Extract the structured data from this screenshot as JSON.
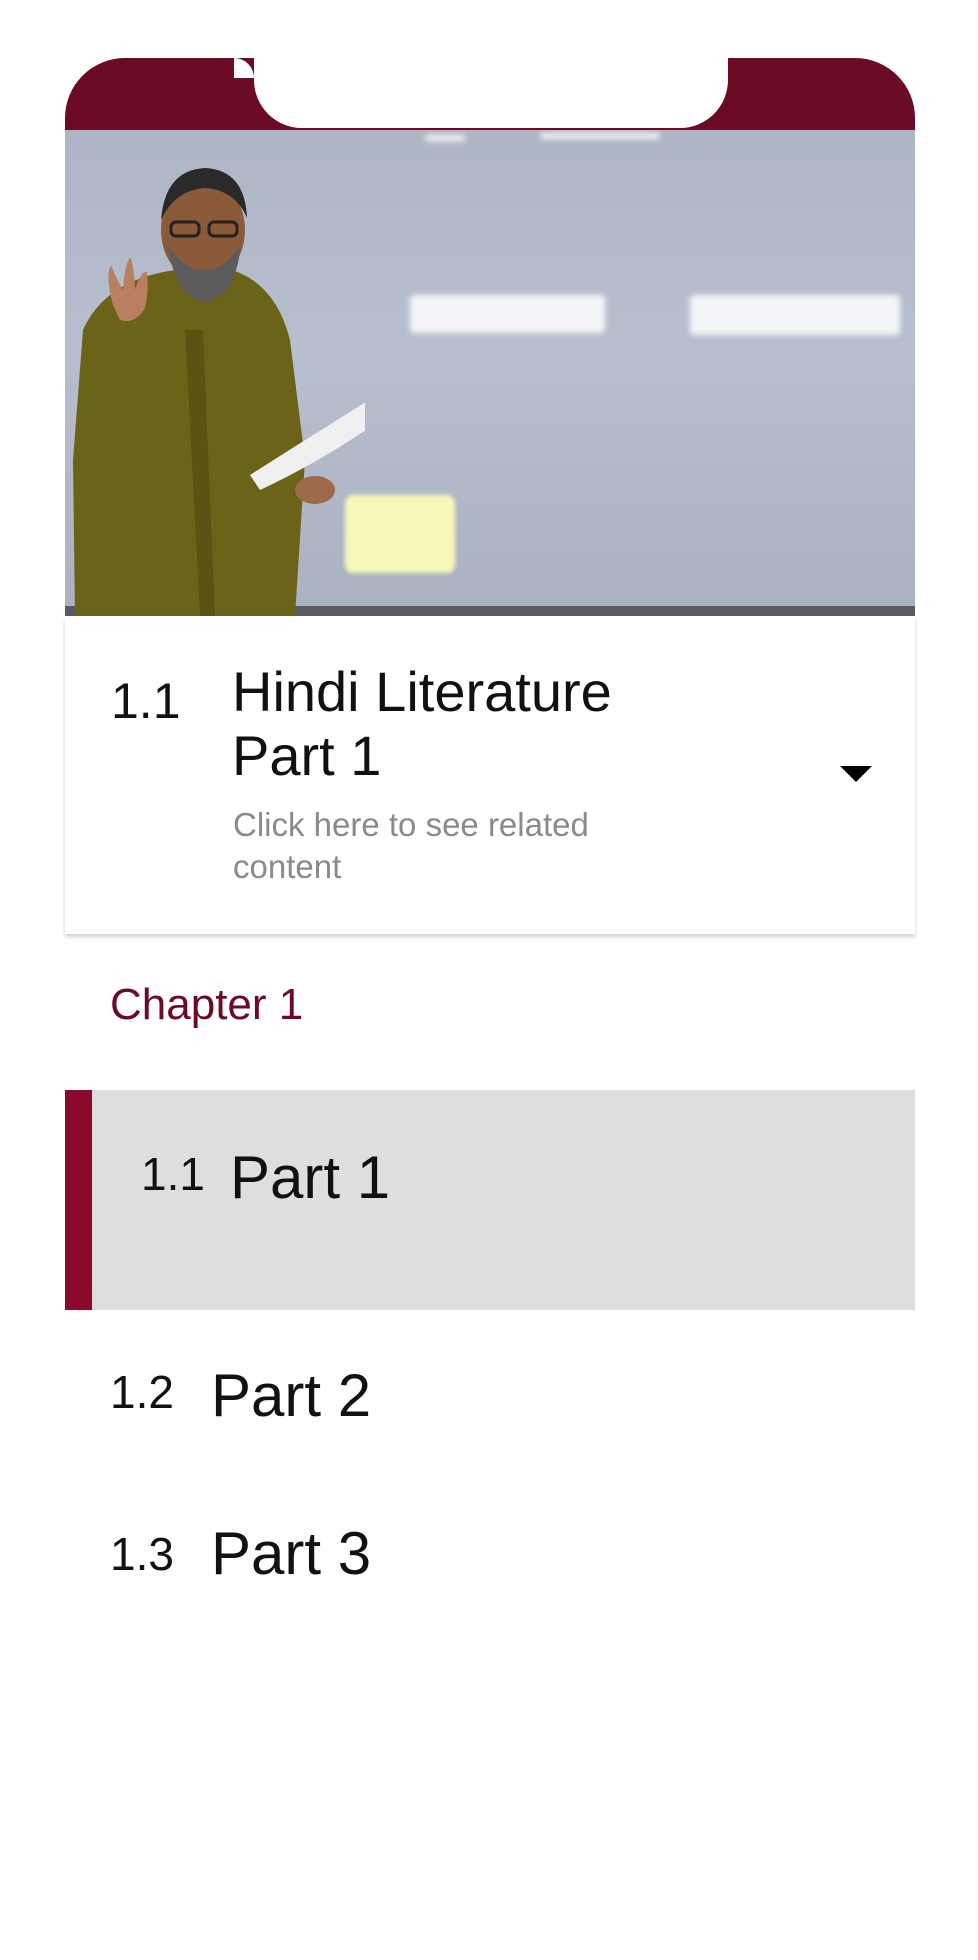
{
  "app": {
    "accent_color": "#6a0a25",
    "active_indicator_color": "#8b0a2c"
  },
  "video": {
    "icon": "video-thumbnail"
  },
  "lesson": {
    "number": "1.1",
    "title_line1": "Hindi Literature",
    "title_line2": "Part 1",
    "subtitle": "Click here to see related content",
    "dropdown_icon": "caret-down"
  },
  "chapter": {
    "title": "Chapter 1",
    "items": [
      {
        "number": "1.1",
        "label": "Part 1",
        "active": true
      },
      {
        "number": "1.2",
        "label": "Part 2",
        "active": false
      },
      {
        "number": "1.3",
        "label": "Part 3",
        "active": false
      }
    ]
  }
}
